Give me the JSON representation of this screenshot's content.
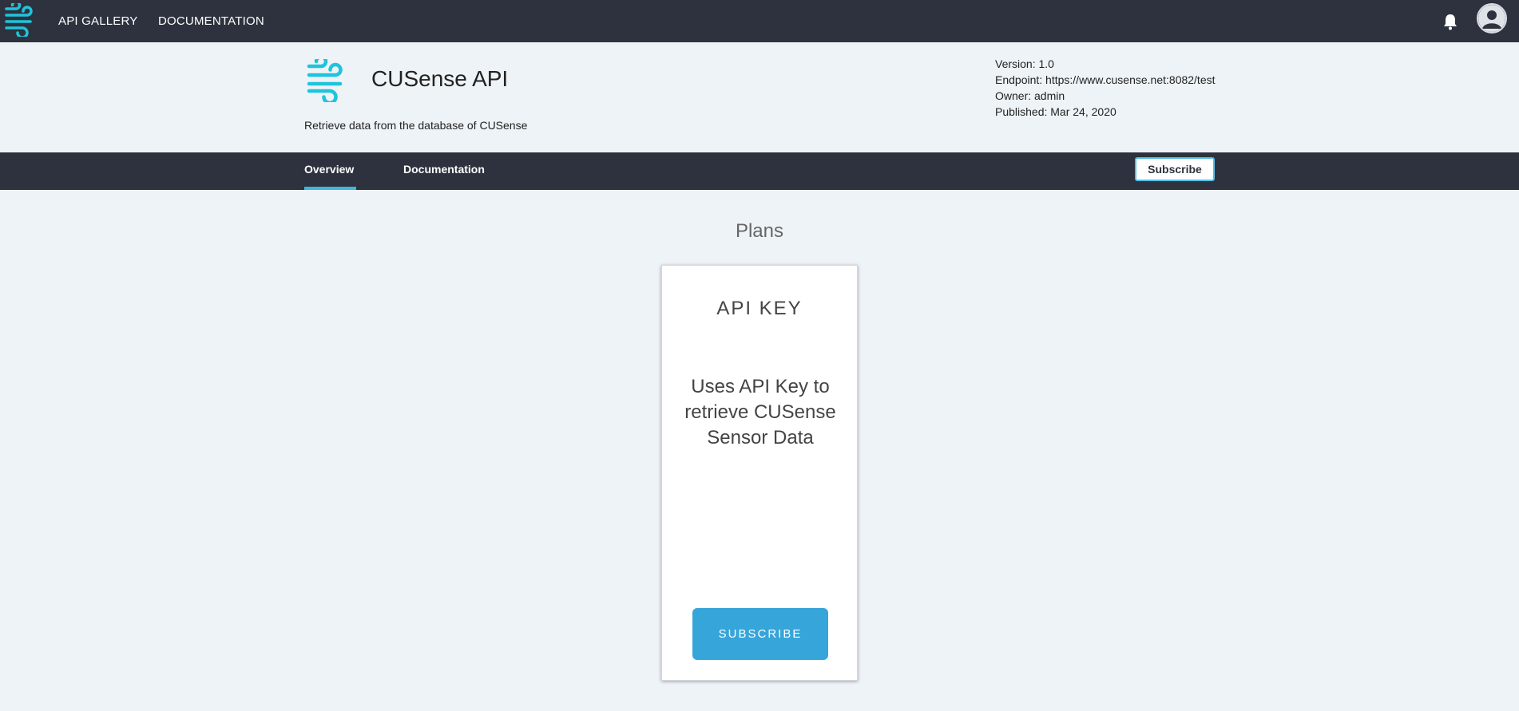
{
  "topbar": {
    "logo_icon": "wind-icon",
    "nav": [
      "API GALLERY",
      "DOCUMENTATION"
    ],
    "notification_icon": "bell-icon",
    "avatar_icon": "user-icon"
  },
  "api": {
    "name": "CUSense API",
    "description": "Retrieve data from the database of CUSense",
    "version": "Version: 1.0",
    "endpoint": "Endpoint: https://www.cusense.net:8082/test",
    "owner": "Owner: admin",
    "published": "Published: Mar 24, 2020"
  },
  "tabs": {
    "overview": "Overview",
    "documentation": "Documentation",
    "subscribe": "Subscribe"
  },
  "plans": {
    "title": "Plans",
    "card": {
      "title": "API KEY",
      "description": "Uses API Key to retrieve CUSense Sensor Data",
      "button": "SUBSCRIBE"
    }
  },
  "colors": {
    "dark_bar": "#2d323e",
    "accent": "#3fb6e0",
    "button": "#36a5da",
    "background": "#eef3f7"
  }
}
